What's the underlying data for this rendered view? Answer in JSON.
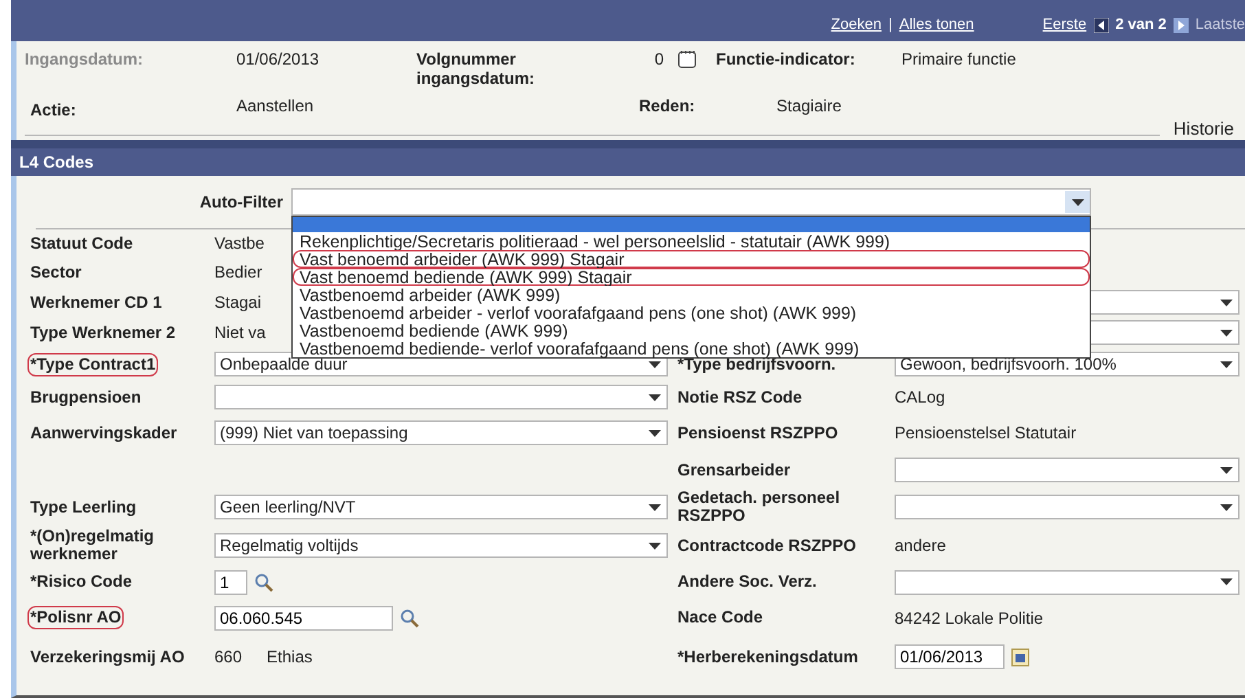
{
  "nav": {
    "links": [
      {
        "label": "Zoeken"
      },
      {
        "label": "Alles tonen"
      }
    ],
    "separator": "|",
    "pager": {
      "first": {
        "label": "Eerste",
        "disabled": false
      },
      "position": "2 van 2",
      "last": {
        "label": "Laatste",
        "disabled": true
      }
    }
  },
  "header": {
    "rows": [
      [
        {
          "kind": "text",
          "label": "Ingangsdatum:",
          "value": "01/06/2013",
          "disabled": true
        },
        {
          "kind": "icon",
          "label": "Volgnummer ingangsdatum:",
          "value": "0",
          "disabled": false
        },
        {
          "kind": "text",
          "label": "Functie-indicator:",
          "value": "Primaire functie",
          "disabled": false
        }
      ],
      [
        {
          "label": "Actie:",
          "value": "Aanstellen",
          "disabled": false
        },
        {
          "label": "Reden:",
          "value": "Stagiaire",
          "disabled": false
        }
      ]
    ],
    "link": "Historie"
  },
  "section": {
    "title": "L4 Codes",
    "auto_filter": {
      "label": "Auto-Filter",
      "open": true,
      "options": [
        {
          "selected": true,
          "circled": false
        },
        {
          "label": "Rekenplichtige/Secretaris politieraad - wel personeelslid - statutair (AWK 999)",
          "selected": false,
          "circled": false
        },
        {
          "label": "Vast benoemd arbeider (AWK 999) Stagair",
          "selected": false,
          "circled": true
        },
        {
          "label": "Vast benoemd bediende (AWK 999) Stagair",
          "selected": false,
          "circled": true
        },
        {
          "label": "Vastbenoemd arbeider (AWK 999)",
          "selected": false,
          "circled": false
        },
        {
          "label": "Vastbenoemd arbeider - verlof voorafafgaand pens (one shot) (AWK 999)",
          "selected": false,
          "circled": false
        },
        {
          "label": "Vastbenoemd bediende (AWK 999)",
          "selected": false,
          "circled": false
        },
        {
          "label": "Vastbenoemd bediende- verlof voorafafgaand pens (one shot) (AWK 999)",
          "selected": false,
          "circled": false
        }
      ]
    },
    "rows": [
      {
        "left": {
          "label": "Statuut Code",
          "kind": "text",
          "value": "Vastbe",
          "circled": false
        }
      },
      {
        "left": {
          "label": "Sector",
          "kind": "text",
          "value": "Bedier",
          "circled": false
        }
      },
      {
        "left": {
          "label": "Werknemer CD 1",
          "kind": "text",
          "value": "Stagai",
          "circled": false
        },
        "right": {
          "kind": "select"
        }
      },
      {
        "left": {
          "label": "Type Werknemer 2",
          "kind": "text",
          "value": "Niet va",
          "circled": false
        },
        "right": {
          "kind": "select"
        }
      },
      {
        "left": {
          "label": "*Type Contract1",
          "kind": "select",
          "value": "Onbepaalde duur",
          "circled": true
        },
        "right": {
          "label": "*Type bedrijfsvoorn.",
          "kind": "select",
          "value": "Gewoon, bedrijfsvoorh. 100%"
        }
      },
      {
        "left": {
          "label": "Brugpensioen",
          "kind": "select",
          "circled": false
        },
        "right": {
          "label": "Notie RSZ Code",
          "kind": "text",
          "value": "CALog"
        }
      },
      {
        "left": {
          "label": "Aanwervingskader",
          "kind": "select",
          "value": "(999) Niet van toepassing",
          "circled": false
        },
        "right": {
          "label": "Pensioenst RSZPPO",
          "kind": "text",
          "value": "Pensioenstelsel Statutair"
        }
      },
      {
        "right": {
          "label": "Grensarbeider",
          "kind": "select"
        }
      },
      {
        "left": {
          "label": "Type Leerling",
          "kind": "select",
          "value": "Geen leerling/NVT",
          "circled": false
        },
        "right": {
          "label": "Gedetach. personeel RSZPPO",
          "kind": "select"
        }
      },
      {
        "left": {
          "label": "*(On)regelmatig werknemer",
          "kind": "select",
          "value": "Regelmatig voltijds",
          "circled": false
        },
        "right": {
          "label": "Contractcode RSZPPO",
          "kind": "text",
          "value": "andere"
        }
      },
      {
        "left": {
          "label": "*Risico Code",
          "kind": "lookup",
          "value": "1",
          "circled": false
        },
        "right": {
          "label": "Andere Soc. Verz.",
          "kind": "select"
        }
      },
      {
        "left": {
          "label": "*Polisnr AO",
          "kind": "lookup",
          "value": "06.060.545",
          "circled": true
        },
        "right": {
          "label": "Nace Code",
          "kind": "text",
          "value": "84242 Lokale Politie"
        }
      },
      {
        "left": {
          "label": "Verzekeringsmij AO",
          "kind": "pair",
          "value": "660",
          "extra": "Ethias",
          "circled": false
        },
        "right": {
          "label": "*Herberekeningsdatum",
          "kind": "date",
          "value": "01/06/2013"
        }
      }
    ]
  }
}
